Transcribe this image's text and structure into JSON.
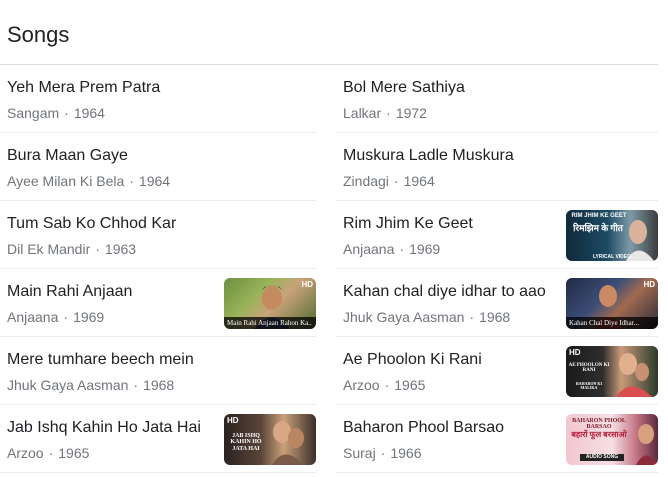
{
  "section_title": "Songs",
  "left_songs": [
    {
      "name": "Yeh Mera Prem Patra",
      "film": "Sangam",
      "year": "1964"
    },
    {
      "name": "Bura Maan Gaye",
      "film": "Ayee Milan Ki Bela",
      "year": "1964"
    },
    {
      "name": "Tum Sab Ko Chhod Kar",
      "film": "Dil Ek Mandir",
      "year": "1963"
    },
    {
      "name": "Main Rahi Anjaan",
      "film": "Anjaana",
      "year": "1969",
      "thumb": {
        "caption": "Main Rahi Anjaan Rahon Ka..",
        "badge": "HD"
      }
    },
    {
      "name": "Mere tumhare beech mein",
      "film": "Jhuk Gaya Aasman",
      "year": "1968"
    },
    {
      "name": "Jab Ishq Kahin Ho Jata Hai",
      "film": "Arzoo",
      "year": "1965",
      "thumb": {
        "badge": "HD",
        "overlay": "JAB ISHQ KAHIN HO JATA HAI"
      }
    }
  ],
  "right_songs": [
    {
      "name": "Bol Mere Sathiya",
      "film": "Lalkar",
      "year": "1972"
    },
    {
      "name": "Muskura Ladle Muskura",
      "film": "Zindagi",
      "year": "1964"
    },
    {
      "name": "Rim Jhim Ke Geet",
      "film": "Anjaana",
      "year": "1969",
      "thumb": {
        "top_text": "RIM JHIM KE GEET",
        "hindi": "रिमझिम के गीत",
        "footer": "LYRICAL VIDEO"
      }
    },
    {
      "name": "Kahan chal diye idhar to aao",
      "film": "Jhuk Gaya Aasman",
      "year": "1968",
      "thumb": {
        "caption": "Kahan Chal Diye Idhar...",
        "badge": "HD"
      }
    },
    {
      "name": "Ae Phoolon Ki Rani",
      "film": "Arzoo",
      "year": "1965",
      "thumb": {
        "badge": "HD",
        "overlay": "AE PHOOLON KI RANI",
        "sub": "BAHARON KI MALIKA"
      }
    },
    {
      "name": "Baharon Phool Barsao",
      "film": "Suraj",
      "year": "1966",
      "thumb": {
        "top_text": "BAHARON PHOOL BARSAO",
        "hindi": "बहारों फूल बरसाओ",
        "footer": "AUDIO SONG"
      }
    }
  ],
  "separator": "·",
  "colors": {
    "title": "#202124",
    "meta": "#70757a",
    "divider": "#ebebeb"
  }
}
